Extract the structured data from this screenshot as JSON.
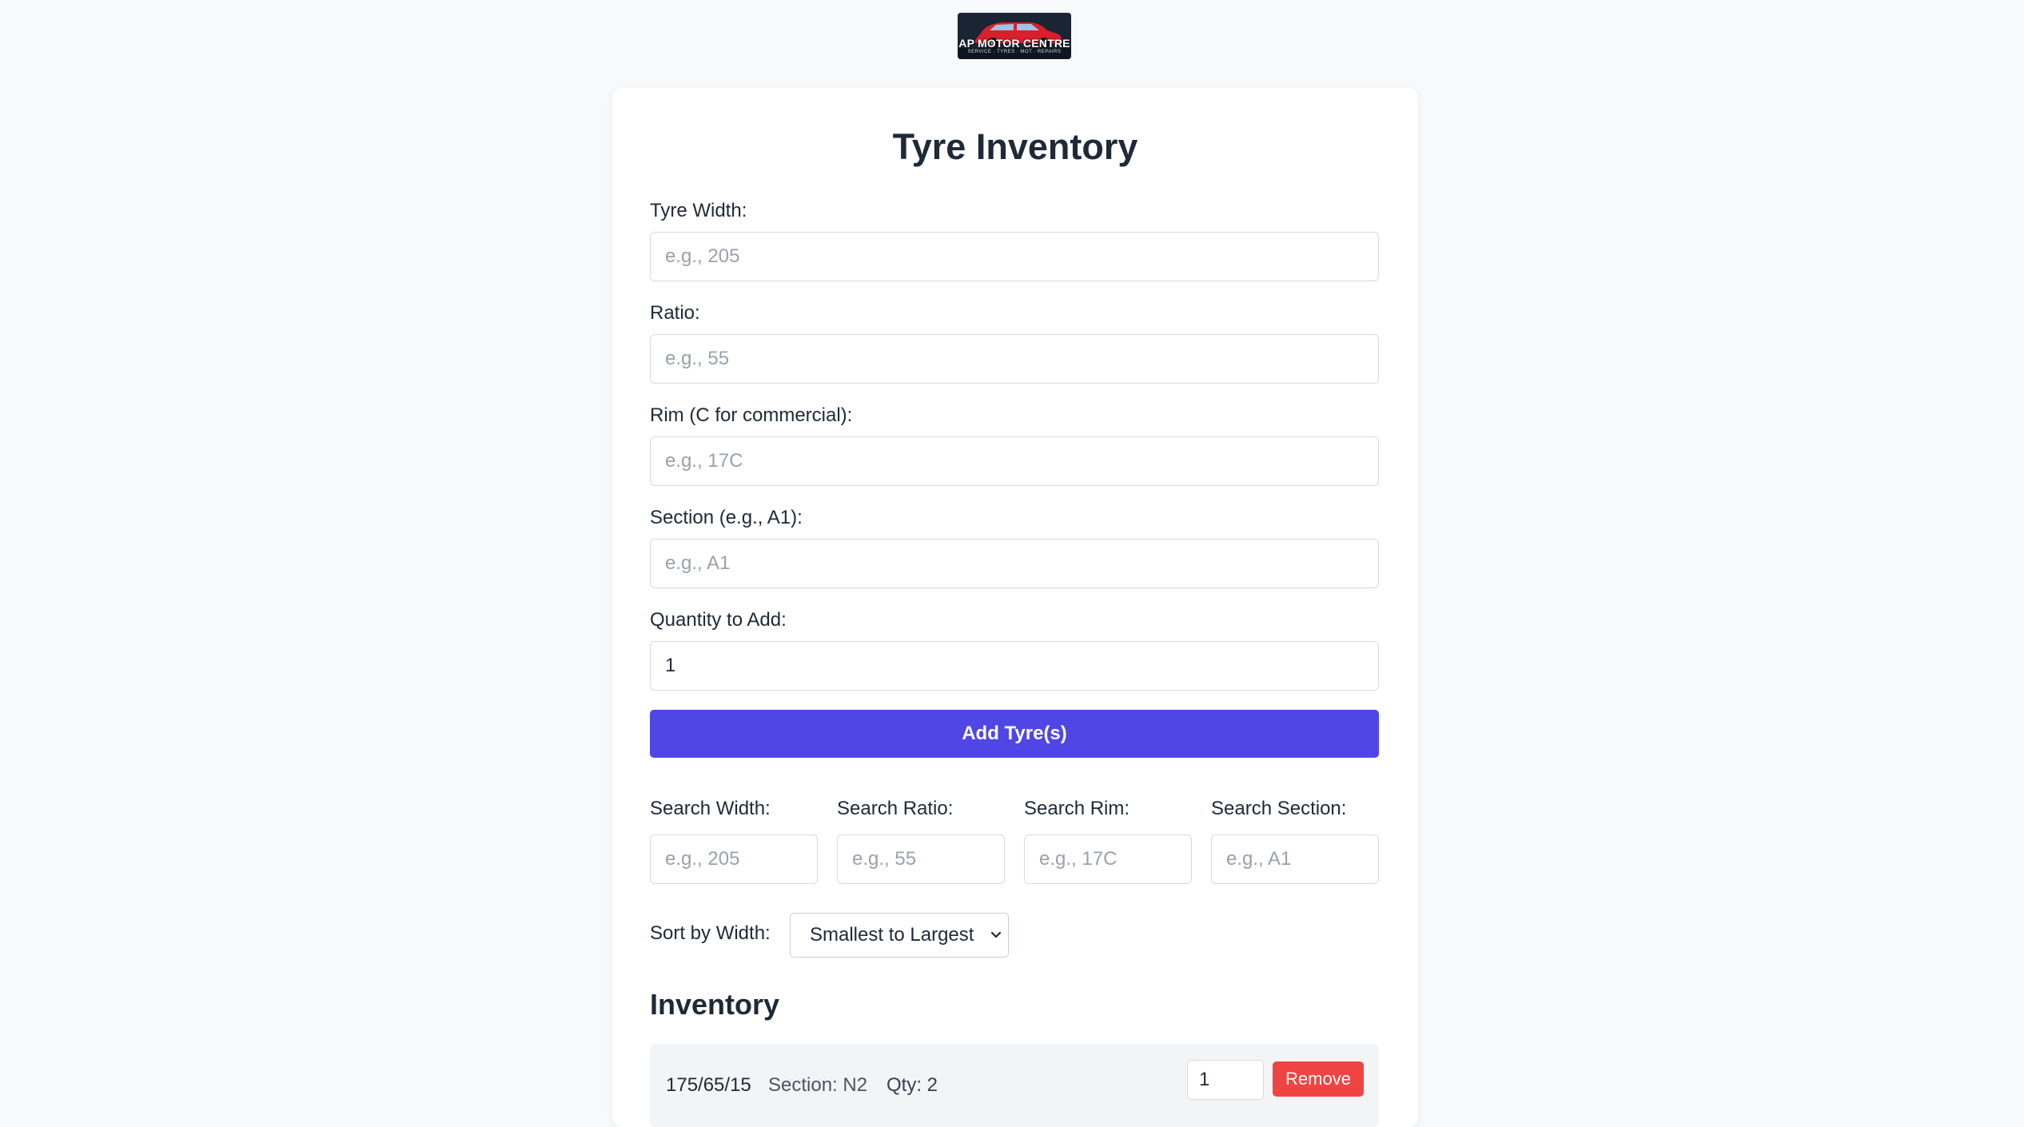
{
  "logo": {
    "name": "AP MOTOR CENTRE",
    "tagline": "SERVICE · TYRES · MOT · REPAIRS"
  },
  "page": {
    "title": "Tyre Inventory"
  },
  "form": {
    "width": {
      "label": "Tyre Width:",
      "placeholder": "e.g., 205",
      "value": ""
    },
    "ratio": {
      "label": "Ratio:",
      "placeholder": "e.g., 55",
      "value": ""
    },
    "rim": {
      "label": "Rim (C for commercial):",
      "placeholder": "e.g., 17C",
      "value": ""
    },
    "section": {
      "label": "Section (e.g., A1):",
      "placeholder": "e.g., A1",
      "value": ""
    },
    "quantity": {
      "label": "Quantity to Add:",
      "placeholder": "",
      "value": "1"
    },
    "add_label": "Add Tyre(s)"
  },
  "search": {
    "width": {
      "label": "Search Width:",
      "placeholder": "e.g., 205"
    },
    "ratio": {
      "label": "Search Ratio:",
      "placeholder": "e.g., 55"
    },
    "rim": {
      "label": "Search Rim:",
      "placeholder": "e.g., 17C"
    },
    "section": {
      "label": "Search Section:",
      "placeholder": "e.g., A1"
    }
  },
  "sort": {
    "label": "Sort by Width:",
    "selected": "Smallest to Largest"
  },
  "inventory": {
    "title": "Inventory",
    "items": [
      {
        "size": "175/65/15",
        "section": "Section: N2",
        "qty": "Qty: 2",
        "remove_qty": "1",
        "remove_label": "Remove"
      }
    ]
  },
  "colors": {
    "accent": "#4f46e5",
    "danger": "#ef4444",
    "background": "#f8f9fb",
    "card": "#ffffff",
    "row": "#f3f4f6"
  }
}
